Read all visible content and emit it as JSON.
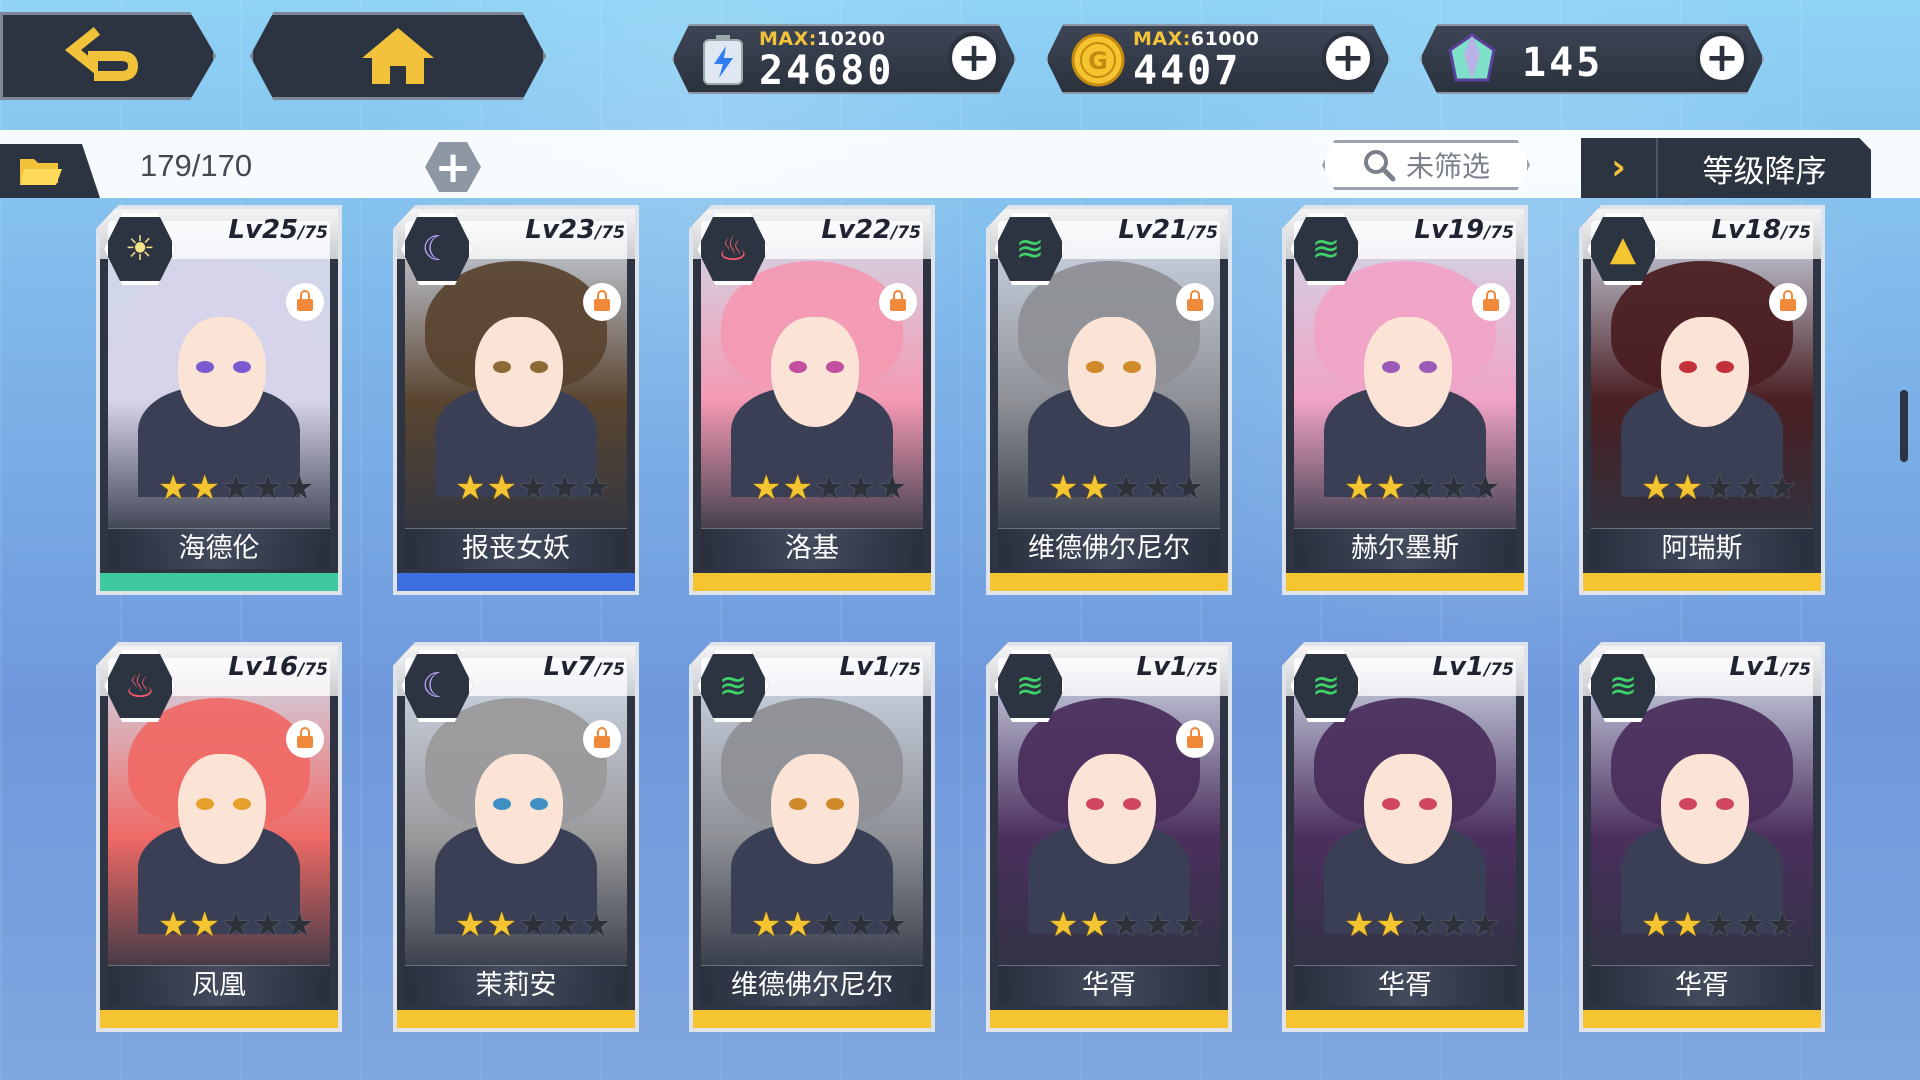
{
  "resources": [
    {
      "id": "energy",
      "max_label": "MAX:",
      "max_value": "10200",
      "value": "24680",
      "icon": "energy-battery-icon"
    },
    {
      "id": "gold",
      "max_label": "MAX:",
      "max_value": "61000",
      "value": "4407",
      "icon": "gold-coin-icon"
    },
    {
      "id": "gem",
      "value": "145",
      "icon": "crystal-gem-icon"
    }
  ],
  "toolbar": {
    "count": "179/170",
    "filter_label": "未筛选",
    "sort_label": "等级降序",
    "sort_chevron": "›"
  },
  "colors": {
    "rarity_green": "#3ec9a0",
    "rarity_blue": "#3d6fe0",
    "rarity_gold": "#f5c531",
    "dark": "#2c3441"
  },
  "cards": [
    {
      "name": "海德伦",
      "level": "Lv25",
      "cap": "/75",
      "element": "sun",
      "stars": 2,
      "locked": true,
      "rarity": "green",
      "hair": "#d7d3ea",
      "eye": "#7a5ad1"
    },
    {
      "name": "报丧女妖",
      "level": "Lv23",
      "cap": "/75",
      "element": "moon",
      "stars": 2,
      "locked": true,
      "rarity": "blue",
      "hair": "#5a4530",
      "eye": "#8a6a35"
    },
    {
      "name": "洛基",
      "level": "Lv22",
      "cap": "/75",
      "element": "fire",
      "stars": 2,
      "locked": true,
      "rarity": "gold",
      "hair": "#f49ab3",
      "eye": "#c24fa0"
    },
    {
      "name": "维德佛尔尼尔",
      "level": "Lv21",
      "cap": "/75",
      "element": "wind",
      "stars": 2,
      "locked": true,
      "rarity": "gold",
      "hair": "#8e9096",
      "eye": "#d08a2a"
    },
    {
      "name": "赫尔墨斯",
      "level": "Lv19",
      "cap": "/75",
      "element": "wind",
      "stars": 2,
      "locked": true,
      "rarity": "gold",
      "hair": "#f0a3c6",
      "eye": "#9a5bb8"
    },
    {
      "name": "阿瑞斯",
      "level": "Lv18",
      "cap": "/75",
      "element": "earth",
      "stars": 2,
      "locked": true,
      "rarity": "gold",
      "hair": "#4a1f23",
      "eye": "#c2303a"
    },
    {
      "name": "凤凰",
      "level": "Lv16",
      "cap": "/75",
      "element": "fire",
      "stars": 2,
      "locked": true,
      "rarity": "gold",
      "hair": "#ef6a66",
      "eye": "#e6a12c"
    },
    {
      "name": "茉莉安",
      "level": "Lv7",
      "cap": "/75",
      "element": "moon",
      "stars": 2,
      "locked": true,
      "rarity": "gold",
      "hair": "#9a9a9c",
      "eye": "#3f8fc2"
    },
    {
      "name": "维德佛尔尼尔",
      "level": "Lv1",
      "cap": "/75",
      "element": "wind",
      "stars": 2,
      "locked": false,
      "rarity": "gold",
      "hair": "#8e9096",
      "eye": "#d08a2a"
    },
    {
      "name": "华胥",
      "level": "Lv1",
      "cap": "/75",
      "element": "wind",
      "stars": 2,
      "locked": true,
      "rarity": "gold",
      "hair": "#4b2f5d",
      "eye": "#d0465f"
    },
    {
      "name": "华胥",
      "level": "Lv1",
      "cap": "/75",
      "element": "wind",
      "stars": 2,
      "locked": false,
      "rarity": "gold",
      "hair": "#4b2f5d",
      "eye": "#d0465f"
    },
    {
      "name": "华胥",
      "level": "Lv1",
      "cap": "/75",
      "element": "wind",
      "stars": 2,
      "locked": false,
      "rarity": "gold",
      "hair": "#4b2f5d",
      "eye": "#d0465f"
    }
  ],
  "max_stars": 5
}
